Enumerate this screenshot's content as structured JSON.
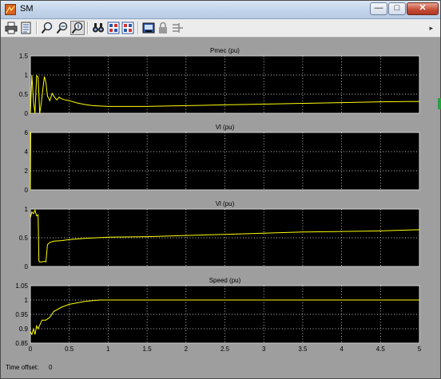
{
  "window": {
    "title": "SM"
  },
  "titlebar_buttons": {
    "minimize": "—",
    "maximize": "□",
    "close": "✕"
  },
  "toolbar": {
    "items": [
      {
        "name": "print-icon",
        "tooltip": "Print"
      },
      {
        "name": "parameters-icon",
        "tooltip": "Parameters"
      },
      {
        "name": "zoom-icon",
        "tooltip": "Zoom"
      },
      {
        "name": "zoom-x-icon",
        "tooltip": "Zoom X-axis"
      },
      {
        "name": "zoom-y-icon",
        "tooltip": "Zoom Y-axis"
      },
      {
        "name": "autoscale-icon",
        "tooltip": "Autoscale"
      },
      {
        "name": "save-axes-icon",
        "tooltip": "Save current axes settings"
      },
      {
        "name": "restore-axes-icon",
        "tooltip": "Restore saved axes settings"
      },
      {
        "name": "floating-scope-icon",
        "tooltip": "Floating scope"
      },
      {
        "name": "lock-icon",
        "tooltip": "Lock axes selection"
      },
      {
        "name": "signal-selector-icon",
        "tooltip": "Signal selector"
      }
    ]
  },
  "status": {
    "offset_label": "Time offset:",
    "offset_value": "0"
  },
  "colors": {
    "trace": "#ffff00",
    "axes_bg": "#000000",
    "figure_bg": "#9e9e9e",
    "grid": "#ffffff"
  },
  "chart_data": [
    {
      "type": "line",
      "title": "Pmec (pu)",
      "xlim": [
        0,
        5
      ],
      "ylim": [
        0,
        1.5
      ],
      "xticks": [
        0,
        0.5,
        1,
        1.5,
        2,
        2.5,
        3,
        3.5,
        4,
        4.5,
        5
      ],
      "yticks": [
        0,
        0.5,
        1,
        1.5
      ],
      "ytick_labels": [
        "0",
        "0.5",
        "1",
        "1.5"
      ],
      "grid": true,
      "series": [
        {
          "x": [
            0,
            0.02,
            0.04,
            0.06,
            0.08,
            0.1,
            0.12,
            0.14,
            0.16,
            0.18,
            0.2,
            0.22,
            0.25,
            0.28,
            0.31,
            0.34,
            0.37,
            0.4,
            0.45,
            0.5,
            0.6,
            0.7,
            0.8,
            1.0,
            1.5,
            2.0,
            2.5,
            3.0,
            3.5,
            4.0,
            4.5,
            5.0
          ],
          "y": [
            0,
            1.0,
            0.3,
            0.0,
            0.98,
            0.95,
            0.0,
            0.25,
            0.62,
            0.96,
            0.8,
            0.45,
            0.33,
            0.52,
            0.42,
            0.35,
            0.42,
            0.38,
            0.35,
            0.33,
            0.27,
            0.23,
            0.2,
            0.18,
            0.18,
            0.2,
            0.22,
            0.24,
            0.26,
            0.28,
            0.3,
            0.31
          ]
        }
      ]
    },
    {
      "type": "line",
      "title": "Vl (pu)",
      "xlim": [
        0,
        5
      ],
      "ylim": [
        0,
        6
      ],
      "xticks": [
        0,
        0.5,
        1,
        1.5,
        2,
        2.5,
        3,
        3.5,
        4,
        4.5,
        5
      ],
      "yticks": [
        0,
        2,
        4,
        6
      ],
      "ytick_labels": [
        "0",
        "2",
        "4",
        "6"
      ],
      "grid": true,
      "series": [
        {
          "x": [
            0,
            0.005,
            0.01
          ],
          "y": [
            0,
            6,
            6
          ]
        }
      ]
    },
    {
      "type": "line",
      "title": "Vl (pu)",
      "xlim": [
        0,
        5
      ],
      "ylim": [
        0,
        1
      ],
      "xticks": [
        0,
        0.5,
        1,
        1.5,
        2,
        2.5,
        3,
        3.5,
        4,
        4.5,
        5
      ],
      "yticks": [
        0,
        0.5,
        1
      ],
      "ytick_labels": [
        "0",
        "0.5",
        "1"
      ],
      "grid": true,
      "series": [
        {
          "x": [
            0,
            0.02,
            0.04,
            0.06,
            0.08,
            0.1,
            0.11,
            0.12,
            0.15,
            0.18,
            0.2,
            0.22,
            0.25,
            0.3,
            0.4,
            0.5,
            0.7,
            1.0,
            1.5,
            2.0,
            2.5,
            3.0,
            3.5,
            4.0,
            4.5,
            5.0
          ],
          "y": [
            0.85,
            0.95,
            0.92,
            0.98,
            0.88,
            0.9,
            0.1,
            0.08,
            0.08,
            0.09,
            0.08,
            0.38,
            0.42,
            0.44,
            0.45,
            0.47,
            0.49,
            0.51,
            0.52,
            0.54,
            0.56,
            0.58,
            0.6,
            0.61,
            0.62,
            0.64
          ]
        }
      ]
    },
    {
      "type": "line",
      "title": "Speed (pu)",
      "xlim": [
        0,
        5
      ],
      "ylim": [
        0.85,
        1.05
      ],
      "xticks": [
        0,
        0.5,
        1,
        1.5,
        2,
        2.5,
        3,
        3.5,
        4,
        4.5,
        5
      ],
      "xtick_labels": [
        "0",
        "0.5",
        "1",
        "1.5",
        "2",
        "2.5",
        "3",
        "3.5",
        "4",
        "4.5",
        "5"
      ],
      "yticks": [
        0.85,
        0.9,
        0.95,
        1,
        1.05
      ],
      "ytick_labels": [
        "0.85",
        "0.9",
        "0.95",
        "1",
        "1.05"
      ],
      "grid": true,
      "series": [
        {
          "x": [
            0,
            0.02,
            0.04,
            0.06,
            0.08,
            0.1,
            0.15,
            0.2,
            0.25,
            0.3,
            0.4,
            0.5,
            0.6,
            0.7,
            0.8,
            0.9,
            1.0,
            1.2,
            1.4,
            1.6,
            2.0,
            3.0,
            4.0,
            5.0
          ],
          "y": [
            0.89,
            0.88,
            0.9,
            0.88,
            0.91,
            0.9,
            0.93,
            0.93,
            0.94,
            0.96,
            0.975,
            0.985,
            0.99,
            0.995,
            0.998,
            1.0,
            1.0,
            1.0,
            1.0,
            1.0,
            1.0,
            1.0,
            1.0,
            1.0
          ]
        }
      ]
    }
  ]
}
